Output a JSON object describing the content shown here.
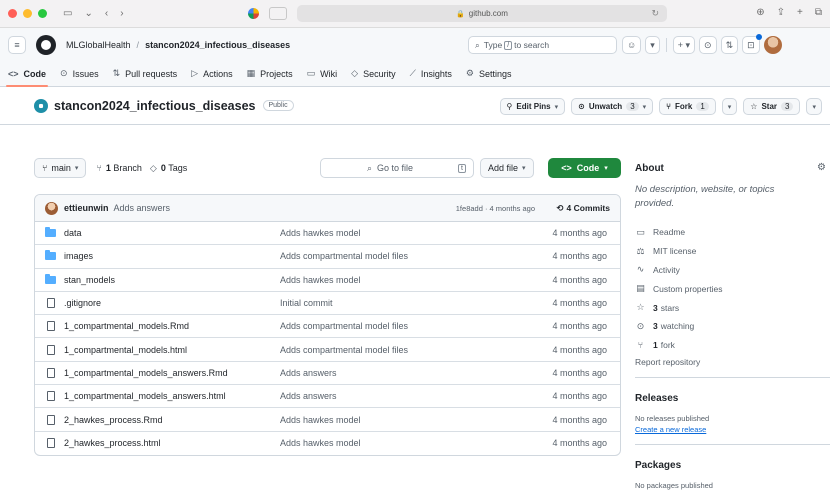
{
  "browser": {
    "url": "github.com"
  },
  "header": {
    "owner": "MLGlobalHealth",
    "separator": "/",
    "repo": "stancon2024_infectious_diseases",
    "search_pre": "Type",
    "search_key": "/",
    "search_post": "to search"
  },
  "tabs": [
    {
      "label": "Code",
      "icon": "<>"
    },
    {
      "label": "Issues",
      "icon": "⊙"
    },
    {
      "label": "Pull requests",
      "icon": "⇅"
    },
    {
      "label": "Actions",
      "icon": "▷"
    },
    {
      "label": "Projects",
      "icon": "▦"
    },
    {
      "label": "Wiki",
      "icon": "▭"
    },
    {
      "label": "Security",
      "icon": "◇"
    },
    {
      "label": "Insights",
      "icon": "⟋"
    },
    {
      "label": "Settings",
      "icon": "⚙"
    }
  ],
  "title": {
    "repo_name": "stancon2024_infectious_diseases",
    "visibility": "Public",
    "edit_pins": "Edit Pins",
    "unwatch": "Unwatch",
    "watch_count": "3",
    "fork": "Fork",
    "fork_count": "1",
    "star": "Star",
    "star_count": "3"
  },
  "toolbar": {
    "branch": "main",
    "branch_count": "1",
    "branch_label": "Branch",
    "tag_count": "0",
    "tag_label": "Tags",
    "goto_placeholder": "Go to file",
    "goto_key": "t",
    "add_file": "Add file",
    "code": "Code"
  },
  "commit": {
    "author": "ettieunwin",
    "message": "Adds answers",
    "hash_time": "1fe8add · 4 months ago",
    "count": "4 Commits"
  },
  "files": [
    {
      "name": "data",
      "type": "folder",
      "message": "Adds hawkes model",
      "date": "4 months ago"
    },
    {
      "name": "images",
      "type": "folder",
      "message": "Adds compartmental model files",
      "date": "4 months ago"
    },
    {
      "name": "stan_models",
      "type": "folder",
      "message": "Adds hawkes model",
      "date": "4 months ago"
    },
    {
      "name": ".gitignore",
      "type": "file",
      "message": "Initial commit",
      "date": "4 months ago"
    },
    {
      "name": "1_compartmental_models.Rmd",
      "type": "file",
      "message": "Adds compartmental model files",
      "date": "4 months ago"
    },
    {
      "name": "1_compartmental_models.html",
      "type": "file",
      "message": "Adds compartmental model files",
      "date": "4 months ago"
    },
    {
      "name": "1_compartmental_models_answers.Rmd",
      "type": "file",
      "message": "Adds answers",
      "date": "4 months ago"
    },
    {
      "name": "1_compartmental_models_answers.html",
      "type": "file",
      "message": "Adds answers",
      "date": "4 months ago"
    },
    {
      "name": "2_hawkes_process.Rmd",
      "type": "file",
      "message": "Adds hawkes model",
      "date": "4 months ago"
    },
    {
      "name": "2_hawkes_process.html",
      "type": "file",
      "message": "Adds hawkes model",
      "date": "4 months ago"
    }
  ],
  "about": {
    "heading": "About",
    "description": "No description, website, or topics provided.",
    "readme": "Readme",
    "license": "MIT license",
    "activity": "Activity",
    "custom_props": "Custom properties",
    "stars_num": "3",
    "stars_label": "stars",
    "watching_num": "3",
    "watching_label": "watching",
    "fork_num": "1",
    "fork_label": "fork",
    "report": "Report repository"
  },
  "releases": {
    "heading": "Releases",
    "none": "No releases published",
    "create": "Create a new release"
  },
  "packages": {
    "heading": "Packages",
    "none": "No packages published"
  }
}
